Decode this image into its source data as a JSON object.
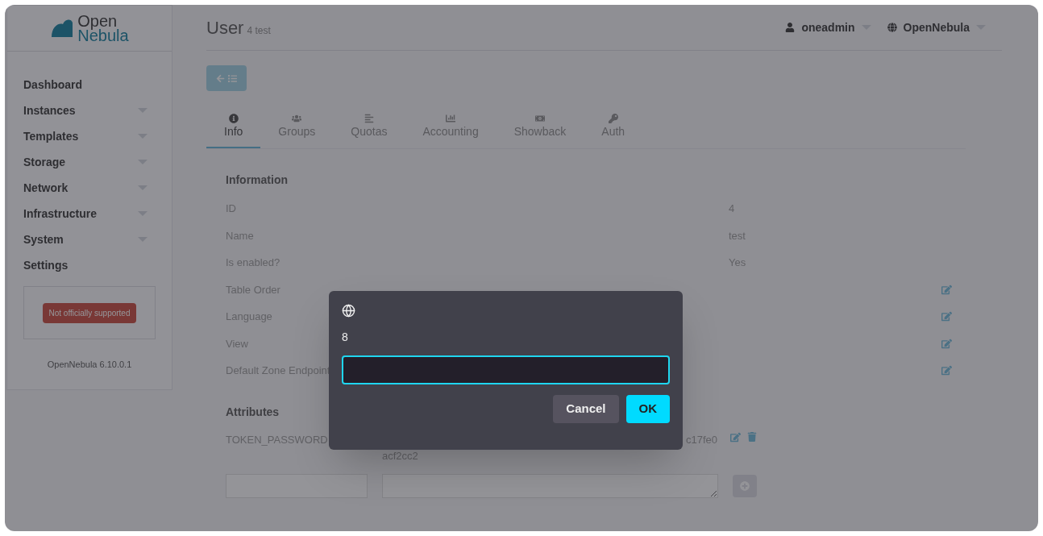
{
  "sidebar": {
    "logo": {
      "line_1": "Open",
      "line_2": "Nebula"
    },
    "items": [
      {
        "label": "Dashboard",
        "expandable": false
      },
      {
        "label": "Instances",
        "expandable": true
      },
      {
        "label": "Templates",
        "expandable": true
      },
      {
        "label": "Storage",
        "expandable": true
      },
      {
        "label": "Network",
        "expandable": true
      },
      {
        "label": "Infrastructure",
        "expandable": true
      },
      {
        "label": "System",
        "expandable": true
      },
      {
        "label": "Settings",
        "expandable": false
      }
    ],
    "badge": "Not officially supported",
    "version": "OpenNebula 6.10.0.1"
  },
  "header": {
    "title": "User",
    "subtitle": "4 test",
    "user": "oneadmin",
    "zone": "OpenNebula"
  },
  "tabs": [
    {
      "label": "Info",
      "selected": true
    },
    {
      "label": "Groups",
      "selected": false
    },
    {
      "label": "Quotas",
      "selected": false
    },
    {
      "label": "Accounting",
      "selected": false
    },
    {
      "label": "Showback",
      "selected": false
    },
    {
      "label": "Auth",
      "selected": false
    }
  ],
  "information": {
    "title": "Information",
    "rows": [
      {
        "label": "ID",
        "value": "4",
        "editable": false
      },
      {
        "label": "Name",
        "value": "test",
        "editable": false
      },
      {
        "label": "Is enabled?",
        "value": "Yes",
        "editable": false
      },
      {
        "label": "Table Order",
        "editable": true
      },
      {
        "label": "Language",
        "editable": true
      },
      {
        "label": "View",
        "editable": true
      },
      {
        "label": "Default Zone Endpoint",
        "editable": true
      }
    ]
  },
  "attributes": {
    "title": "Attributes",
    "rows": [
      {
        "key": "TOKEN_PASSWORD",
        "value_line_1": "c17fe0",
        "value_line_2": "acf2cc2"
      }
    ]
  },
  "dialog": {
    "label": "8",
    "buttons": [
      {
        "label": "Cancel",
        "kind": "secondary"
      },
      {
        "label": "OK",
        "kind": "primary"
      }
    ]
  }
}
